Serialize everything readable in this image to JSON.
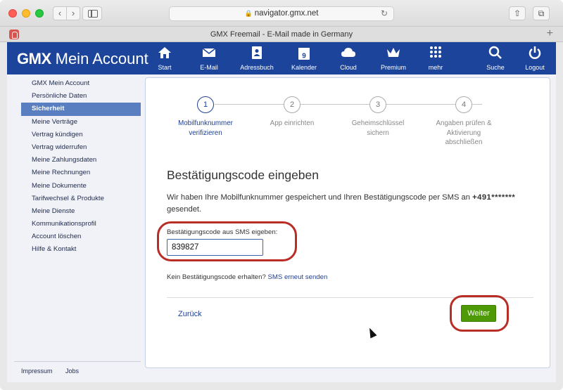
{
  "browser": {
    "url": "navigator.gmx.net",
    "tab_title": "GMX Freemail - E-Mail made in Germany"
  },
  "header": {
    "brand_bold": "GMX",
    "brand_rest": "Mein Account",
    "nav": [
      {
        "label": "Start",
        "icon": "home-icon"
      },
      {
        "label": "E-Mail",
        "icon": "mail-icon"
      },
      {
        "label": "Adressbuch",
        "icon": "addressbook-icon"
      },
      {
        "label": "Kalender",
        "icon": "calendar-icon",
        "day": "9"
      },
      {
        "label": "Cloud",
        "icon": "cloud-icon"
      },
      {
        "label": "Premium",
        "icon": "crown-icon"
      },
      {
        "label": "mehr",
        "icon": "grid-icon"
      },
      {
        "label": "Suche",
        "icon": "search-icon"
      },
      {
        "label": "Logout",
        "icon": "power-icon"
      }
    ]
  },
  "sidebar": {
    "items": [
      {
        "label": "GMX Mein Account"
      },
      {
        "label": "Persönliche Daten"
      },
      {
        "label": "Sicherheit",
        "active": true
      },
      {
        "label": "Meine Verträge"
      },
      {
        "label": "Vertrag kündigen"
      },
      {
        "label": "Vertrag widerrufen"
      },
      {
        "label": "Meine Zahlungsdaten"
      },
      {
        "label": "Meine Rechnungen"
      },
      {
        "label": "Meine Dokumente"
      },
      {
        "label": "Tarifwechsel & Produkte"
      },
      {
        "label": "Meine Dienste"
      },
      {
        "label": "Kommunikationsprofil"
      },
      {
        "label": "Account löschen"
      },
      {
        "label": "Hilfe & Kontakt"
      }
    ],
    "footer": [
      "Impressum",
      "Jobs"
    ]
  },
  "wizard": {
    "steps": [
      {
        "num": "1",
        "label_line1": "Mobilfunknummer",
        "label_line2": "verifizieren",
        "label_line3": "",
        "active": true
      },
      {
        "num": "2",
        "label_line1": "App einrichten",
        "label_line2": "",
        "label_line3": ""
      },
      {
        "num": "3",
        "label_line1": "Geheimschlüssel",
        "label_line2": "sichern",
        "label_line3": ""
      },
      {
        "num": "4",
        "label_line1": "Angaben prüfen &",
        "label_line2": "Aktivierung",
        "label_line3": "abschließen"
      }
    ]
  },
  "form": {
    "title": "Bestätigungscode eingeben",
    "message_part1": "Wir haben Ihre Mobilfunknummer gespeichert und Ihren Bestätigungscode per SMS an",
    "masked_number": "+491*******",
    "message_part2": " gesendet.",
    "code_label": "Bestätigungscode aus SMS eigeben:",
    "code_value": "839827",
    "no_code_text": "Kein Bestätigungscode erhalten? ",
    "resend_link": "SMS erneut senden",
    "back_label": "Zurück",
    "next_label": "Weiter"
  },
  "colors": {
    "header_bg": "#1c449b",
    "active_nav": "#5a7fc0",
    "primary_button": "#4e9a06",
    "highlight_ring": "#b92d27"
  }
}
